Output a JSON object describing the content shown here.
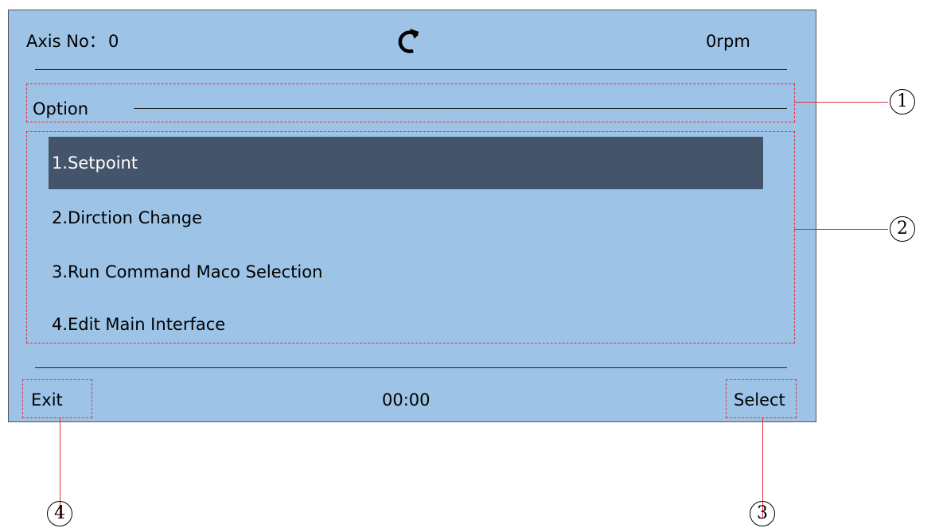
{
  "header": {
    "axis_label": "Axis No：",
    "axis_value": "0",
    "rotation_icon": "rotation-clockwise-icon",
    "speed": "0rpm"
  },
  "option_bar": {
    "title": "Option"
  },
  "menu": {
    "selected_index": 0,
    "items": [
      {
        "label": "1.Setpoint"
      },
      {
        "label": "2.Dirction Change"
      },
      {
        "label": "3.Run Command Maco Selection"
      },
      {
        "label": "4.Edit Main Interface"
      }
    ]
  },
  "footer": {
    "exit_label": "Exit",
    "time": "00:00",
    "select_label": "Select"
  },
  "callouts": {
    "c1": "1",
    "c2": "2",
    "c3": "3",
    "c4": "4"
  },
  "colors": {
    "screen_background": "#9dc3e6",
    "selected_item_background": "#44546a",
    "selected_item_text": "#ffffff",
    "annotation_red": "#e03040"
  }
}
